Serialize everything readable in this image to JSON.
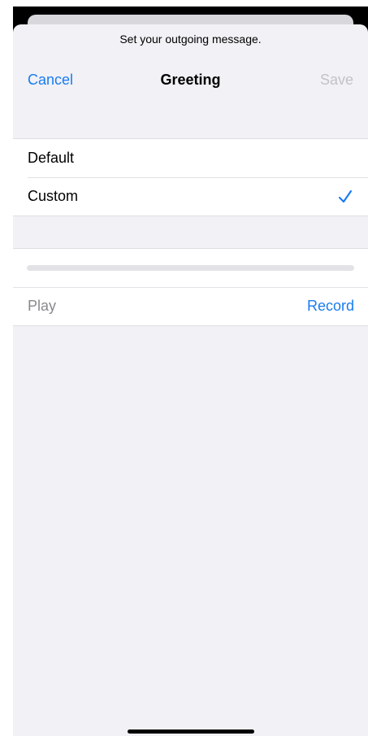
{
  "sheet": {
    "prompt": "Set your outgoing message."
  },
  "navbar": {
    "cancel_label": "Cancel",
    "title": "Greeting",
    "save_label": "Save"
  },
  "options": [
    {
      "label": "Default",
      "selected": false
    },
    {
      "label": "Custom",
      "selected": true
    }
  ],
  "recording": {
    "play_label": "Play",
    "record_label": "Record",
    "progress": 0
  },
  "colors": {
    "accent": "#1a7cf0",
    "disabled": "#c3c3c7",
    "sheet_background": "#f1f1f6"
  },
  "icons": {
    "selected": "checkmark-icon"
  }
}
